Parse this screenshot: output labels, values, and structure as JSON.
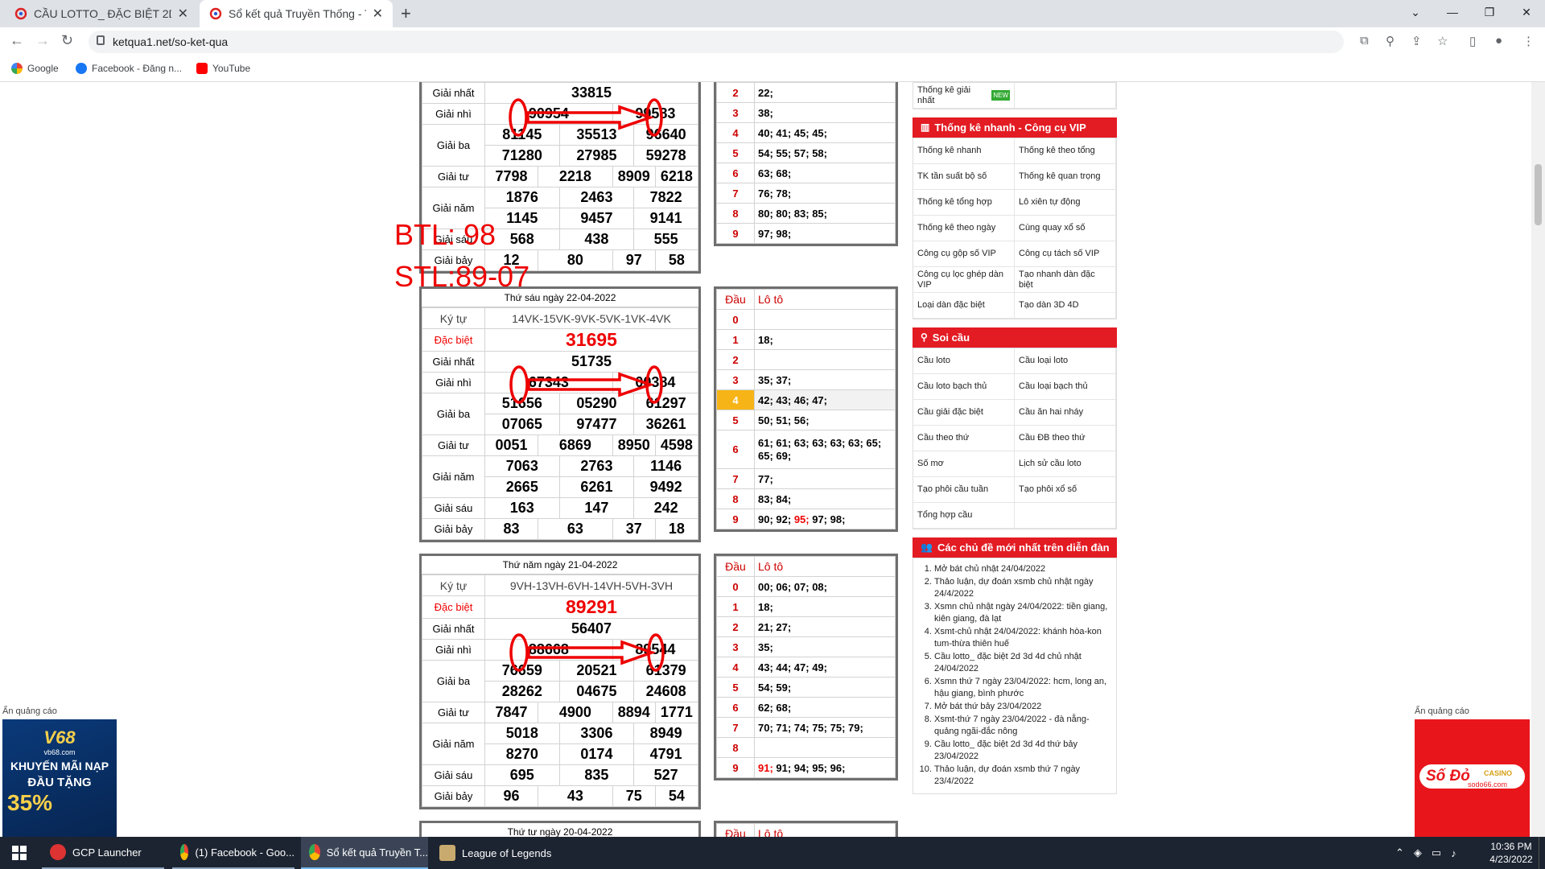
{
  "browser": {
    "tabs": [
      {
        "title": "CẦU LOTTO_ ĐẶC BIỆT 2D 3D 4D"
      },
      {
        "title": "Sổ kết quả Truyền Thống - Tổng"
      }
    ],
    "url": "ketqua1.net/so-ket-qua",
    "bookmarks": [
      "Google",
      "Facebook - Đăng n...",
      "YouTube"
    ]
  },
  "annotations": {
    "btl": "BTL: 98",
    "stl": "STL:89-07"
  },
  "results": [
    {
      "header": "",
      "rows": [
        {
          "label": "Giải nhất",
          "values": [
            "33815"
          ]
        },
        {
          "label": "Giải nhì",
          "values": [
            "90954",
            "99583"
          ]
        },
        {
          "label": "Giải ba",
          "values": [
            "81145",
            "35513",
            "96640",
            "71280",
            "27985",
            "59278"
          ]
        },
        {
          "label": "Giải tư",
          "values": [
            "7798",
            "2218",
            "8909",
            "6218"
          ]
        },
        {
          "label": "Giải năm",
          "values": [
            "1876",
            "2463",
            "7822",
            "1145",
            "9457",
            "9141"
          ]
        },
        {
          "label": "Giải sáu",
          "values": [
            "568",
            "438",
            "555"
          ]
        },
        {
          "label": "Giải bảy",
          "values": [
            "12",
            "80",
            "97",
            "58"
          ]
        }
      ]
    },
    {
      "header": "Thứ sáu ngày 22-04-2022",
      "ky_label": "Ký tự",
      "ky": "14VK-15VK-9VK-5VK-1VK-4VK",
      "db_label": "Đặc biệt",
      "db": "31695",
      "rows": [
        {
          "label": "Giải nhất",
          "values": [
            "51735"
          ]
        },
        {
          "label": "Giải nhì",
          "values": [
            "67343",
            "00384"
          ]
        },
        {
          "label": "Giải ba",
          "values": [
            "51656",
            "05290",
            "61297",
            "07065",
            "97477",
            "36261"
          ]
        },
        {
          "label": "Giải tư",
          "values": [
            "0051",
            "6869",
            "8950",
            "4598"
          ]
        },
        {
          "label": "Giải năm",
          "values": [
            "7063",
            "2763",
            "1146",
            "2665",
            "6261",
            "9492"
          ]
        },
        {
          "label": "Giải sáu",
          "values": [
            "163",
            "147",
            "242"
          ]
        },
        {
          "label": "Giải bảy",
          "values": [
            "83",
            "63",
            "37",
            "18"
          ]
        }
      ]
    },
    {
      "header": "Thứ năm ngày 21-04-2022",
      "ky_label": "Ký tự",
      "ky": "9VH-13VH-6VH-14VH-5VH-3VH",
      "db_label": "Đặc biệt",
      "db": "89291",
      "rows": [
        {
          "label": "Giải nhất",
          "values": [
            "56407"
          ]
        },
        {
          "label": "Giải nhì",
          "values": [
            "88668",
            "89544"
          ]
        },
        {
          "label": "Giải ba",
          "values": [
            "76659",
            "20521",
            "61379",
            "28262",
            "04675",
            "24608"
          ]
        },
        {
          "label": "Giải tư",
          "values": [
            "7847",
            "4900",
            "8894",
            "1771"
          ]
        },
        {
          "label": "Giải năm",
          "values": [
            "5018",
            "3306",
            "8949",
            "8270",
            "0174",
            "4791"
          ]
        },
        {
          "label": "Giải sáu",
          "values": [
            "695",
            "835",
            "527"
          ]
        },
        {
          "label": "Giải bảy",
          "values": [
            "96",
            "43",
            "75",
            "54"
          ]
        }
      ]
    },
    {
      "header": "Thứ tư ngày 20-04-2022"
    }
  ],
  "loto_header": {
    "dau": "Đầu",
    "loto": "Lô tô"
  },
  "loto": [
    {
      "rows": [
        {
          "d": "2",
          "v": "22;"
        },
        {
          "d": "3",
          "v": "38;"
        },
        {
          "d": "4",
          "v": "40; 41; 45; 45;"
        },
        {
          "d": "5",
          "v": "54; 55; 57; 58;"
        },
        {
          "d": "6",
          "v": "63; 68;"
        },
        {
          "d": "7",
          "v": "76; 78;"
        },
        {
          "d": "8",
          "v": "80; 80; 83; 85;"
        },
        {
          "d": "9",
          "v": "97; 98;"
        }
      ]
    },
    {
      "rows": [
        {
          "d": "0",
          "v": ""
        },
        {
          "d": "1",
          "v": "18;"
        },
        {
          "d": "2",
          "v": ""
        },
        {
          "d": "3",
          "v": "35; 37;"
        },
        {
          "d": "4",
          "v": "42; 43; 46; 47;"
        },
        {
          "d": "5",
          "v": "50; 51; 56;"
        },
        {
          "d": "6",
          "v": "61; 61; 63; 63; 63; 63; 65; 65; 69;"
        },
        {
          "d": "7",
          "v": "77;"
        },
        {
          "d": "8",
          "v": "83; 84;"
        },
        {
          "d": "9",
          "v": "90; 92; ",
          "red": "95;",
          "v2": " 97; 98;"
        }
      ]
    },
    {
      "rows": [
        {
          "d": "0",
          "v": "00; 06; 07; 08;"
        },
        {
          "d": "1",
          "v": "18;"
        },
        {
          "d": "2",
          "v": "21; 27;"
        },
        {
          "d": "3",
          "v": "35;"
        },
        {
          "d": "4",
          "v": "43; 44; 47; 49;"
        },
        {
          "d": "5",
          "v": "54; 59;"
        },
        {
          "d": "6",
          "v": "62; 68;"
        },
        {
          "d": "7",
          "v": "70; 71; 74; 75; 75; 79;"
        },
        {
          "d": "8",
          "v": ""
        },
        {
          "d": "9",
          "v": "",
          "red": "91;",
          "v2": " 91; 94; 95; 96;"
        }
      ]
    }
  ],
  "sidebar": {
    "top_item": "Thống kê giải nhất",
    "new_badge": "NEW",
    "vip": {
      "title": "Thống kê nhanh - Công cụ VIP",
      "items": [
        "Thống kê nhanh",
        "Thống kê theo tổng",
        "TK tần suất bộ số",
        "Thống kê quan trọng",
        "Thống kê tổng hợp",
        "Lô xiên tự động",
        "Thống kê theo ngày",
        "Cùng quay xổ số",
        "Công cụ gộp số VIP",
        "Công cụ tách số VIP",
        "Công cụ lọc ghép dàn VIP",
        "Tạo nhanh dàn đặc biệt",
        "Loại dàn đặc biệt",
        "Tạo dàn 3D 4D"
      ]
    },
    "soicau": {
      "title": "Soi cầu",
      "items": [
        "Cầu loto",
        "Cầu loại loto",
        "Cầu loto bạch thủ",
        "Cầu loại bạch thủ",
        "Cầu giải đặc biệt",
        "Cầu ăn hai nháy",
        "Cầu theo thứ",
        "Cầu ĐB theo thứ",
        "Số mơ",
        "Lịch sử cầu loto",
        "Tạo phôi cầu tuần",
        "Tạo phôi xổ số",
        "Tổng hợp cầu",
        ""
      ]
    },
    "forum": {
      "title": "Các chủ đề mới nhất trên diễn đàn",
      "items": [
        "Mở bát chủ nhật 24/04/2022",
        "Thảo luận, dự đoán xsmb chủ nhật ngày 24/4/2022",
        "Xsmn chủ nhật ngày 24/04/2022: tiền giang, kiên giang, đà lạt",
        "Xsmt-chủ nhật 24/04/2022: khánh hòa-kon tum-thừa thiên huế",
        "Cầu lotto_ đặc biệt 2d 3d 4d chủ nhật 24/04/2022",
        "Xsmn thứ 7 ngày 23/04/2022: hcm, long an, hậu giang, bình phước",
        "Mở bát thứ bảy 23/04/2022",
        "Xsmt-thứ 7 ngày 23/04/2022 - đà nẵng-quảng ngãi-đắc nông",
        "Cầu lotto_ đặc biệt 2d 3d 4d thứ bảy 23/04/2022",
        "Thảo luận, dự đoán xsmb thứ 7 ngày 23/4/2022"
      ]
    }
  },
  "ads": {
    "left_label": "Ẩn quảng cáo",
    "right_label": "Ẩn quảng cáo",
    "left_brand": "V68",
    "left_site": "vb68.com",
    "left_line1": "KHUYẾN MÃI NẠP",
    "left_line2": "ĐẦU TẶNG",
    "left_pct": "35%",
    "right_brand": "Số Đỏ",
    "right_sub": "CASINO",
    "right_site": "sodo66.com"
  },
  "taskbar": {
    "items": [
      "GCP Launcher",
      "(1) Facebook - Goo...",
      "Sổ kết quả Truyền T...",
      "League of Legends"
    ],
    "time": "10:36 PM",
    "date": "4/23/2022"
  }
}
